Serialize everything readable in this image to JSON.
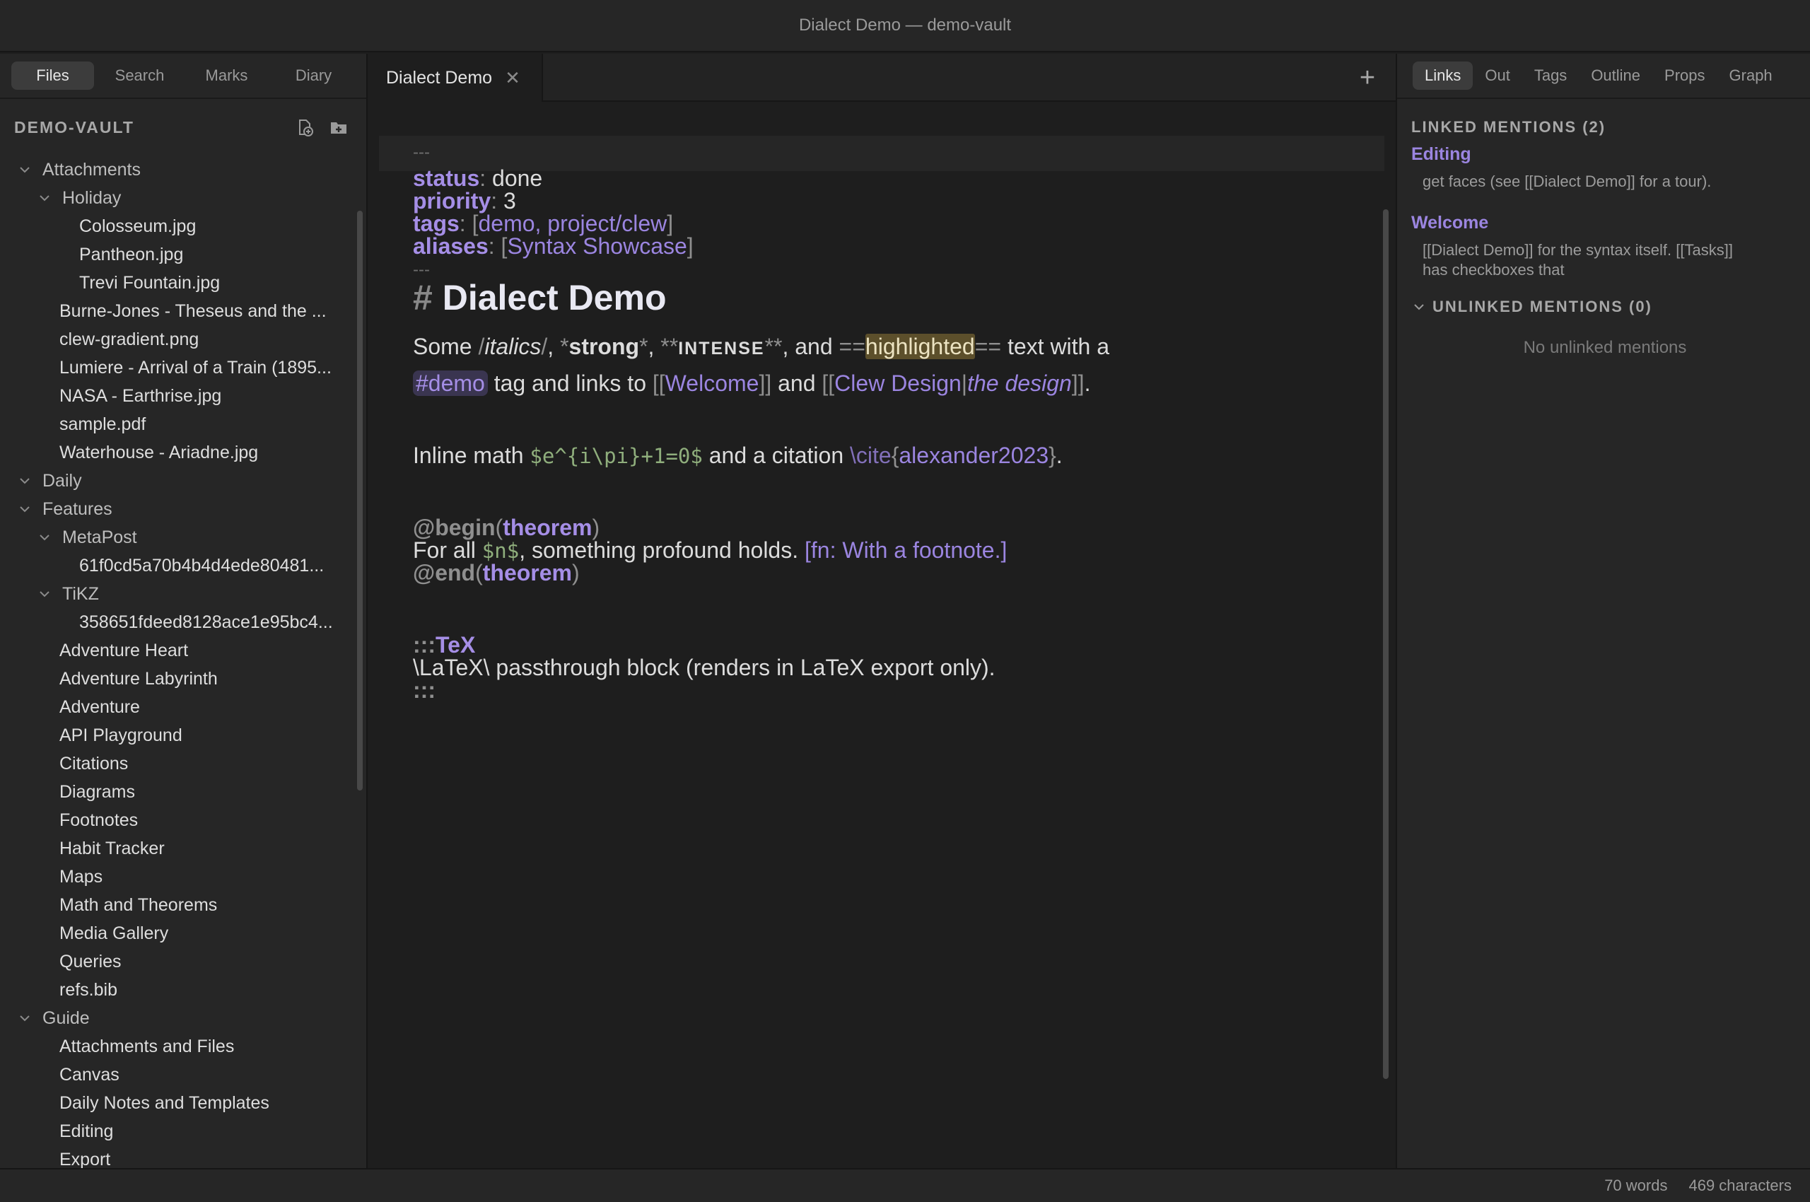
{
  "window": {
    "title": "Dialect Demo — demo-vault"
  },
  "left_tabs": [
    "Files",
    "Search",
    "Marks",
    "Diary"
  ],
  "vault": {
    "name": "DEMO-VAULT",
    "new_note_icon": "new-note-icon",
    "new_folder_icon": "new-folder-icon"
  },
  "tree": [
    {
      "label": "Attachments",
      "depth": 0,
      "folder": true
    },
    {
      "label": "Holiday",
      "depth": 1,
      "folder": true
    },
    {
      "label": "Colosseum.jpg",
      "depth": 2
    },
    {
      "label": "Pantheon.jpg",
      "depth": 2
    },
    {
      "label": "Trevi Fountain.jpg",
      "depth": 2
    },
    {
      "label": "Burne-Jones - Theseus and the ...",
      "depth": 1
    },
    {
      "label": "clew-gradient.png",
      "depth": 1
    },
    {
      "label": "Lumiere - Arrival of a Train (1895...",
      "depth": 1
    },
    {
      "label": "NASA - Earthrise.jpg",
      "depth": 1
    },
    {
      "label": "sample.pdf",
      "depth": 1
    },
    {
      "label": "Waterhouse - Ariadne.jpg",
      "depth": 1
    },
    {
      "label": "Daily",
      "depth": 0,
      "folder": true
    },
    {
      "label": "Features",
      "depth": 0,
      "folder": true
    },
    {
      "label": "MetaPost",
      "depth": 1,
      "folder": true
    },
    {
      "label": "61f0cd5a70b4b4d4ede80481...",
      "depth": 2
    },
    {
      "label": "TiKZ",
      "depth": 1,
      "folder": true
    },
    {
      "label": "358651fdeed8128ace1e95bc4...",
      "depth": 2
    },
    {
      "label": "Adventure Heart",
      "depth": 1
    },
    {
      "label": "Adventure Labyrinth",
      "depth": 1
    },
    {
      "label": "Adventure",
      "depth": 1
    },
    {
      "label": "API Playground",
      "depth": 1
    },
    {
      "label": "Citations",
      "depth": 1
    },
    {
      "label": "Diagrams",
      "depth": 1
    },
    {
      "label": "Footnotes",
      "depth": 1
    },
    {
      "label": "Habit Tracker",
      "depth": 1
    },
    {
      "label": "Maps",
      "depth": 1
    },
    {
      "label": "Math and Theorems",
      "depth": 1
    },
    {
      "label": "Media Gallery",
      "depth": 1
    },
    {
      "label": "Queries",
      "depth": 1
    },
    {
      "label": "refs.bib",
      "depth": 1
    },
    {
      "label": "Guide",
      "depth": 0,
      "folder": true
    },
    {
      "label": "Attachments and Files",
      "depth": 1
    },
    {
      "label": "Canvas",
      "depth": 1
    },
    {
      "label": "Daily Notes and Templates",
      "depth": 1
    },
    {
      "label": "Editing",
      "depth": 1
    },
    {
      "label": "Export",
      "depth": 1
    }
  ],
  "editor": {
    "tab_label": "Dialect Demo",
    "close_glyph": "✕",
    "new_tab_glyph": "+",
    "fm_delim": "---",
    "frontmatter": {
      "status_key": "status",
      "status_val": "done",
      "priority_key": "priority",
      "priority_val": "3",
      "tags_key": "tags",
      "tags_val": "demo, project/clew",
      "aliases_key": "aliases",
      "aliases_val": "Syntax Showcase"
    },
    "heading_hash": "#",
    "heading": "Dialect Demo",
    "p1": {
      "some": "Some ",
      "italics": "italics",
      "strong": "strong",
      "intense": "INTENSE",
      "and": ", and ",
      "highlighted": "highlighted",
      "text_with_a": " text with a",
      "tag": "#demo",
      "tag_and_links_to": " tag and links to ",
      "welcome": "Welcome",
      "and2": " and ",
      "clew_design": "Clew Design",
      "the_design": "the design"
    },
    "p2": {
      "inline_math": "Inline math ",
      "math": "$e^{i\\pi}+1=0$",
      "and_citation": " and a citation ",
      "cite_cmd": "\\cite",
      "cite_key": "alexander2023"
    },
    "p3": {
      "begin": "@begin",
      "theorem": "theorem",
      "for_all": "For all ",
      "n_math": "$n$",
      "something": ", something profound holds. ",
      "footnote": "[fn: With a footnote.]",
      "end": "@end"
    },
    "p4": {
      "fence": ":::",
      "lang": "TeX",
      "body": "\\LaTeX\\ passthrough block (renders in LaTeX export only).",
      "close": ":::"
    }
  },
  "right_tabs": [
    "Links",
    "Out",
    "Tags",
    "Outline",
    "Props",
    "Graph"
  ],
  "linked": {
    "title": "LINKED MENTIONS (2)",
    "items": [
      {
        "title": "Editing",
        "snippet": "get faces (see [[Dialect Demo]] for a tour)."
      },
      {
        "title": "Welcome",
        "snippet": "[[Dialect Demo]] for the syntax itself. [[Tasks]] has checkboxes that"
      }
    ]
  },
  "unlinked": {
    "title": "UNLINKED MENTIONS (0)",
    "empty": "No unlinked mentions"
  },
  "status": {
    "words": "70 words",
    "characters": "469 characters"
  },
  "colors": {
    "accent": "#9b85e0",
    "highlight": "#5c4f2b",
    "math": "#8fae7c"
  }
}
